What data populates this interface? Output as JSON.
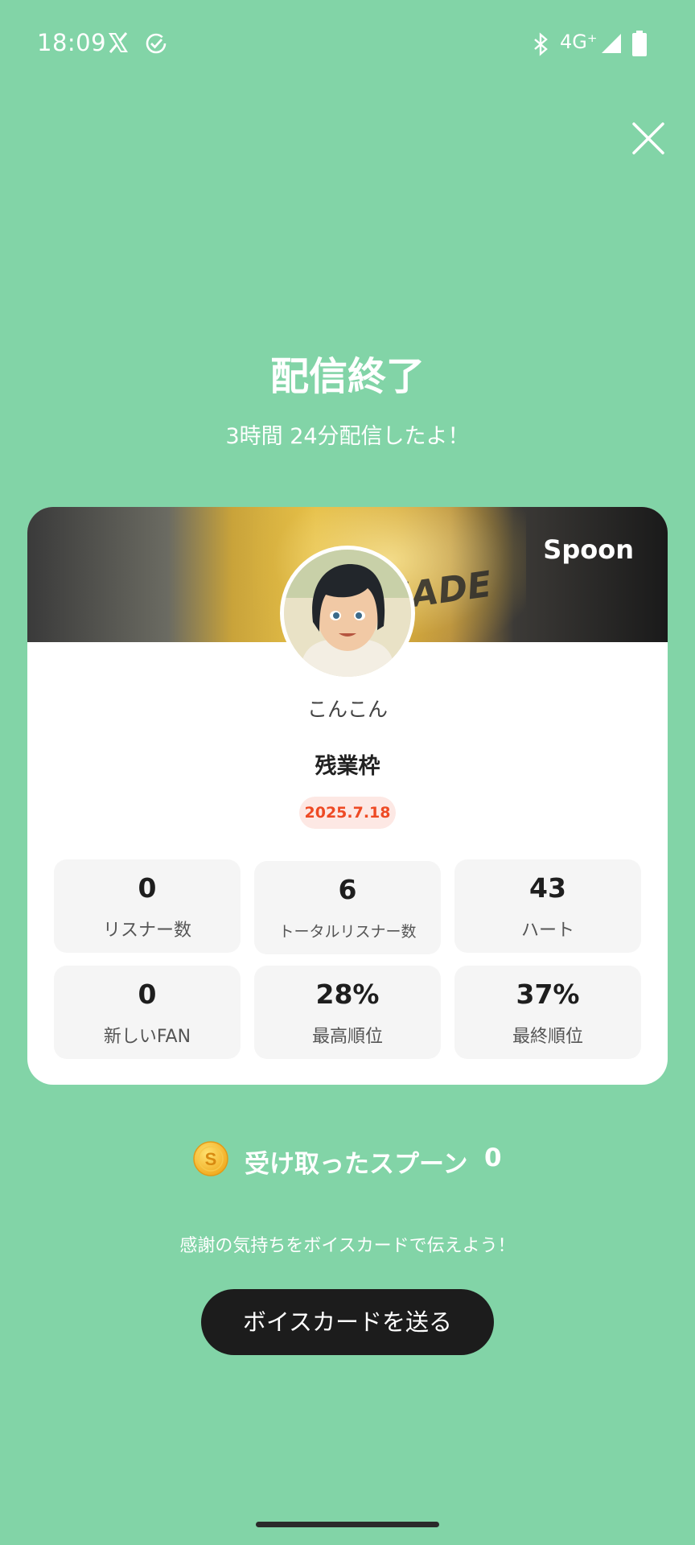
{
  "status_bar": {
    "time": "18:09",
    "network": "4G⁺",
    "icons": [
      "x-logo-icon",
      "check-circle-icon",
      "bluetooth-icon",
      "signal-icon",
      "battery-icon"
    ]
  },
  "header": {
    "close_icon": "close-icon",
    "title": "配信終了",
    "subtitle": "3時間 24分配信したよ！"
  },
  "card": {
    "brand": "Spoon",
    "dj_name": "こんこん",
    "live_title": "残業枠",
    "date": "2025.7.18",
    "stats": [
      {
        "value": "0",
        "label": "リスナー数"
      },
      {
        "value": "6",
        "label": "トータルリスナー数"
      },
      {
        "value": "43",
        "label": "ハート"
      },
      {
        "value": "0",
        "label": "新しいFAN"
      },
      {
        "value": "28%",
        "label": "最高順位"
      },
      {
        "value": "37%",
        "label": "最終順位"
      }
    ]
  },
  "spoons": {
    "label": "受け取ったスプーン",
    "count": "0",
    "coin_letter": "S"
  },
  "voice_card": {
    "prompt": "感謝の気持ちをボイスカードで伝えよう！",
    "button_label": "ボイスカードを送る"
  },
  "colors": {
    "background": "#82d4a7",
    "card": "#ffffff",
    "badge_text": "#ee4a24",
    "badge_bg": "#fde8e4",
    "button": "#1c1c1c"
  }
}
